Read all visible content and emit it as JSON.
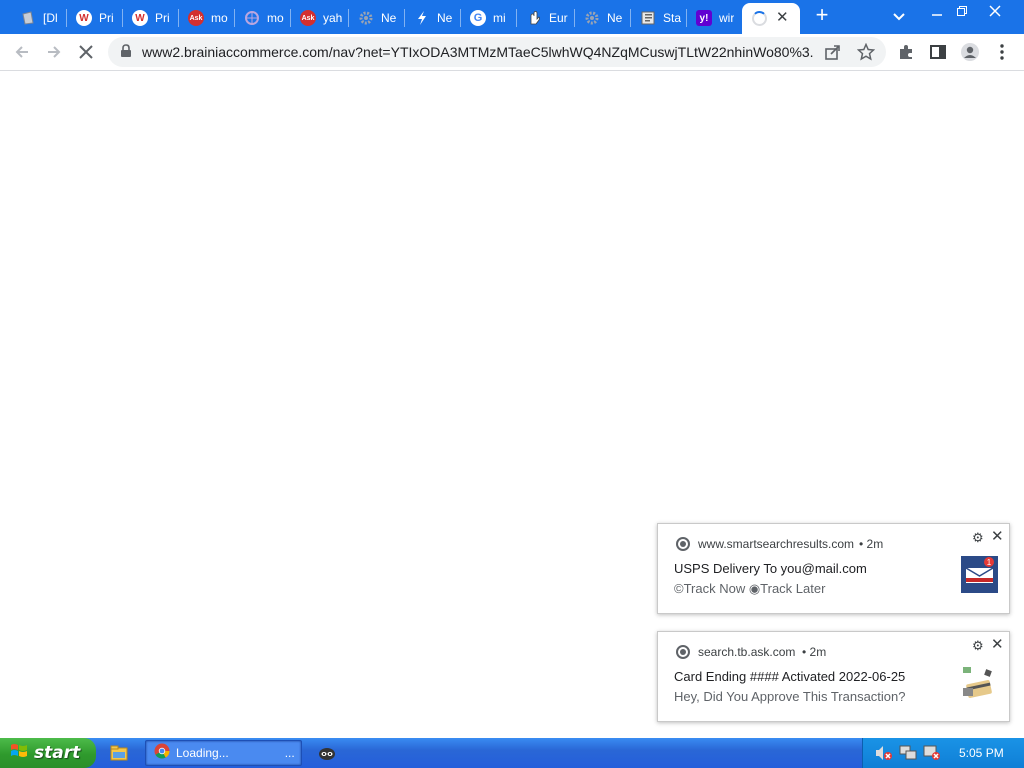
{
  "tabs": [
    {
      "label": "[Dl",
      "icon": "document-icon"
    },
    {
      "label": "Pri",
      "icon": "red-w-icon"
    },
    {
      "label": "Pri",
      "icon": "red-w-icon"
    },
    {
      "label": "mo",
      "icon": "ask-icon"
    },
    {
      "label": "mo",
      "icon": "globe-icon"
    },
    {
      "label": "yah",
      "icon": "ask-icon"
    },
    {
      "label": "Ne",
      "icon": "gear-icon"
    },
    {
      "label": "Ne",
      "icon": "bolt-icon"
    },
    {
      "label": "mi",
      "icon": "google-icon"
    },
    {
      "label": "Eur",
      "icon": "hand-icon"
    },
    {
      "label": "Ne",
      "icon": "gear-icon"
    },
    {
      "label": "Sta",
      "icon": "book-icon"
    },
    {
      "label": "wir",
      "icon": "yahoo-icon"
    }
  ],
  "address_bar": {
    "url": "www2.brainiaccommerce.com/nav?net=YTIxODA3MTMzMTaeC5lwhWQ4NZqMCuswjTLtW22nhinWo80%3..."
  },
  "notifications": [
    {
      "source": "www.smartsearchresults.com",
      "time": "• 2m",
      "title": "USPS Delivery To you@mail.com",
      "body": "©Track Now  ◉Track Later",
      "image": "mail-package-icon",
      "badge": "1"
    },
    {
      "source": "search.tb.ask.com",
      "time": "• 2m",
      "title": "Card Ending #### Activated 2022-06-25",
      "body": "Hey, Did You Approve This Transaction?",
      "image": "credit-card-icon"
    }
  ],
  "taskbar": {
    "start_label": "start",
    "task_label": "Loading...",
    "task_suffix": "...",
    "clock": "5:05 PM"
  },
  "colors": {
    "tabstrip": "#1a73e8",
    "taskbar": "#245edb",
    "start": "#2f9a2d"
  }
}
